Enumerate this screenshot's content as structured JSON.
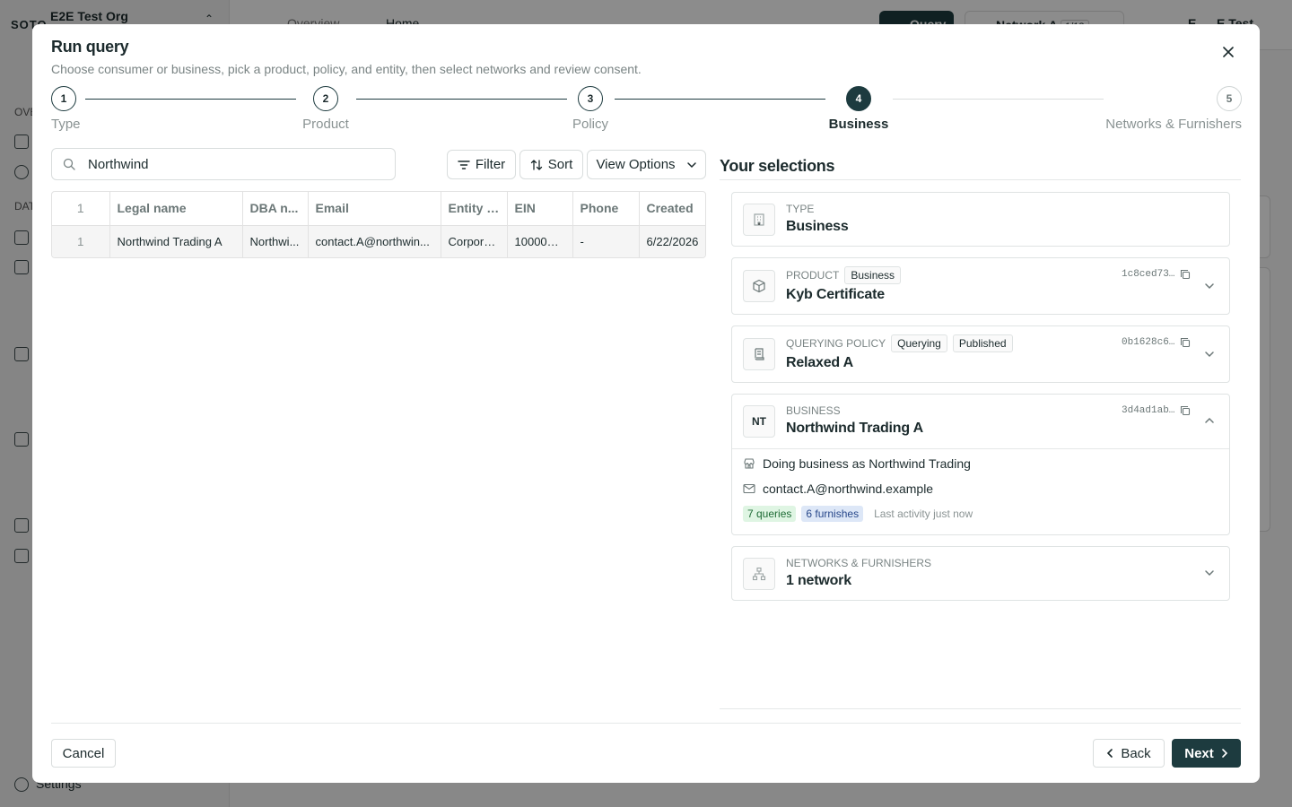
{
  "background": {
    "logo": "SOTO",
    "org_name": "E2E Test Org",
    "sections": [
      "OVE",
      "DAT"
    ],
    "settings": "Settings",
    "breadcrumb": [
      "Overview",
      "Home"
    ],
    "query_button": "Query",
    "network_button": "Network A",
    "network_badge": "1/12",
    "user_initial": "E",
    "user_name": "E Test"
  },
  "modal": {
    "title": "Run query",
    "subtitle": "Choose consumer or business, pick a product, policy, and entity, then select networks and review consent.",
    "close_icon": "close-icon",
    "current_step": 4,
    "steps": [
      {
        "number": "1",
        "label": "Type",
        "state": "done"
      },
      {
        "number": "2",
        "label": "Product",
        "state": "done"
      },
      {
        "number": "3",
        "label": "Policy",
        "state": "done"
      },
      {
        "number": "4",
        "label": "Business",
        "state": "active"
      },
      {
        "number": "5",
        "label": "Networks & Furnishers",
        "state": "pending"
      }
    ],
    "search": {
      "value": "Northwind",
      "icon": "search-icon"
    },
    "toolbar": {
      "filter": "Filter",
      "sort": "Sort",
      "view_options": "View Options"
    },
    "table": {
      "headers": [
        "1",
        "Legal name",
        "DBA n...",
        "Email",
        "Entity t...",
        "EIN",
        "Phone",
        "Created"
      ],
      "rows": [
        [
          "1",
          "Northwind Trading A",
          "Northwi...",
          "contact.A@northwin...",
          "Corpora...",
          "1000000...",
          "-",
          "6/22/2026"
        ]
      ]
    },
    "selections": {
      "title": "Your selections",
      "type": {
        "kicker": "TYPE",
        "value": "Business",
        "icon": "building-icon"
      },
      "product": {
        "kicker": "PRODUCT",
        "badge": "Business",
        "value": "Kyb Certificate",
        "id": "1c8ced73…",
        "icon": "box-icon"
      },
      "policy": {
        "kicker": "QUERYING POLICY",
        "badges": [
          "Querying",
          "Published"
        ],
        "value": "Relaxed A",
        "id": "0b1628c6…",
        "icon": "scroll-icon"
      },
      "business": {
        "kicker": "BUSINESS",
        "initials": "NT",
        "value": "Northwind Trading A",
        "id": "3d4ad1ab…",
        "dba": "Doing business as Northwind Trading",
        "email": "contact.A@northwind.example",
        "queries": "7 queries",
        "furnishes": "6 furnishes",
        "activity": "Last activity just now"
      },
      "networks": {
        "kicker": "NETWORKS & FURNISHERS",
        "value": "1 network",
        "icon": "network-icon"
      }
    },
    "footer": {
      "cancel": "Cancel",
      "back": "Back",
      "next": "Next"
    }
  }
}
